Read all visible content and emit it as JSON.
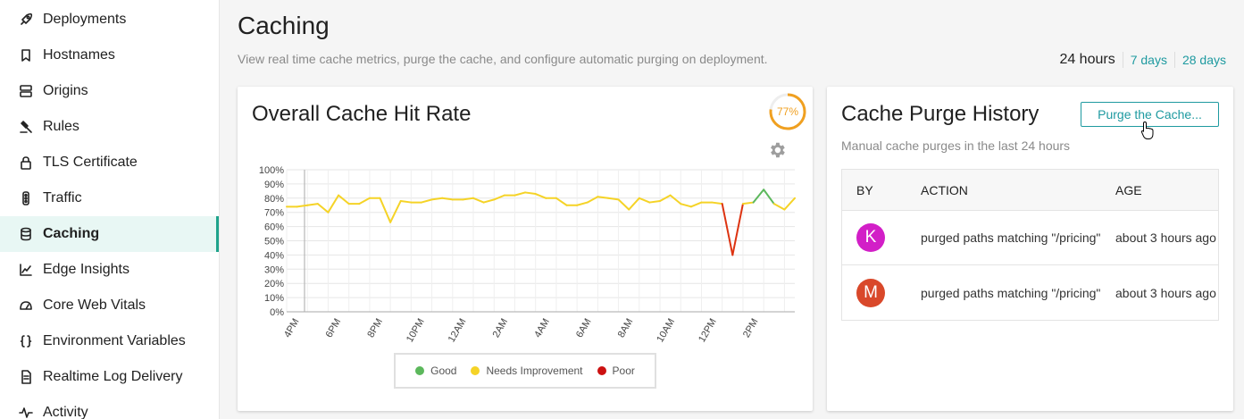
{
  "sidebar": {
    "items": [
      {
        "label": "Deployments",
        "icon": "rocket-icon"
      },
      {
        "label": "Hostnames",
        "icon": "bookmark-icon"
      },
      {
        "label": "Origins",
        "icon": "server-icon"
      },
      {
        "label": "Rules",
        "icon": "gavel-icon"
      },
      {
        "label": "TLS Certificate",
        "icon": "lock-icon"
      },
      {
        "label": "Traffic",
        "icon": "traffic-light-icon"
      },
      {
        "label": "Caching",
        "icon": "database-icon",
        "active": true
      },
      {
        "label": "Edge Insights",
        "icon": "line-chart-icon"
      },
      {
        "label": "Core Web Vitals",
        "icon": "speedometer-icon"
      },
      {
        "label": "Environment Variables",
        "icon": "braces-icon"
      },
      {
        "label": "Realtime Log Delivery",
        "icon": "document-icon"
      },
      {
        "label": "Activity",
        "icon": "activity-icon"
      }
    ],
    "accent_color": "#1ea38b"
  },
  "header": {
    "title": "Caching",
    "subtitle": "View real time cache metrics, purge the cache, and configure automatic purging on deployment.",
    "ranges": [
      "24 hours",
      "7 days",
      "28 days"
    ],
    "active_range": "24 hours"
  },
  "hit_rate_card": {
    "title": "Overall Cache Hit Rate",
    "gauge_value": "77%",
    "gauge_percent": 77,
    "gauge_color": "#f0a020",
    "legend": [
      {
        "label": "Good",
        "color": "#5cb85c"
      },
      {
        "label": "Needs Improvement",
        "color": "#f5d327"
      },
      {
        "label": "Poor",
        "color": "#cc1111"
      }
    ]
  },
  "chart_data": {
    "type": "line",
    "x_tick_labels": [
      "4PM",
      "6PM",
      "8PM",
      "10PM",
      "12AM",
      "2AM",
      "4AM",
      "6AM",
      "8AM",
      "10AM",
      "12PM",
      "2PM"
    ],
    "y_tick_labels": [
      "100%",
      "90%",
      "80%",
      "70%",
      "60%",
      "50%",
      "40%",
      "30%",
      "20%",
      "10%",
      "0%"
    ],
    "ylim": [
      0,
      100
    ],
    "grid": true,
    "legend_position": "bottom",
    "series": [
      {
        "values": [
          74,
          74,
          75,
          76,
          70,
          82,
          76,
          76,
          80,
          80,
          63,
          78,
          77,
          77,
          79,
          80,
          79,
          79,
          80,
          77,
          79,
          82,
          82,
          84,
          83,
          80,
          80,
          75,
          75,
          77,
          81,
          80,
          79,
          72,
          80,
          77,
          78,
          82,
          76,
          74,
          77,
          77,
          76,
          40,
          76,
          77,
          86,
          76,
          72,
          80
        ]
      }
    ]
  },
  "purge_card": {
    "title": "Cache Purge History",
    "button_label": "Purge the Cache...",
    "subtitle": "Manual cache purges in the last 24 hours",
    "columns": [
      "BY",
      "ACTION",
      "AGE"
    ],
    "rows": [
      {
        "avatar": "K",
        "avatar_color": "#d21fc7",
        "action": "purged paths matching \"/pricing\"",
        "age": "about 3 hours ago"
      },
      {
        "avatar": "M",
        "avatar_color": "#d9482a",
        "action": "purged paths matching \"/pricing\"",
        "age": "about 3 hours ago"
      }
    ]
  }
}
